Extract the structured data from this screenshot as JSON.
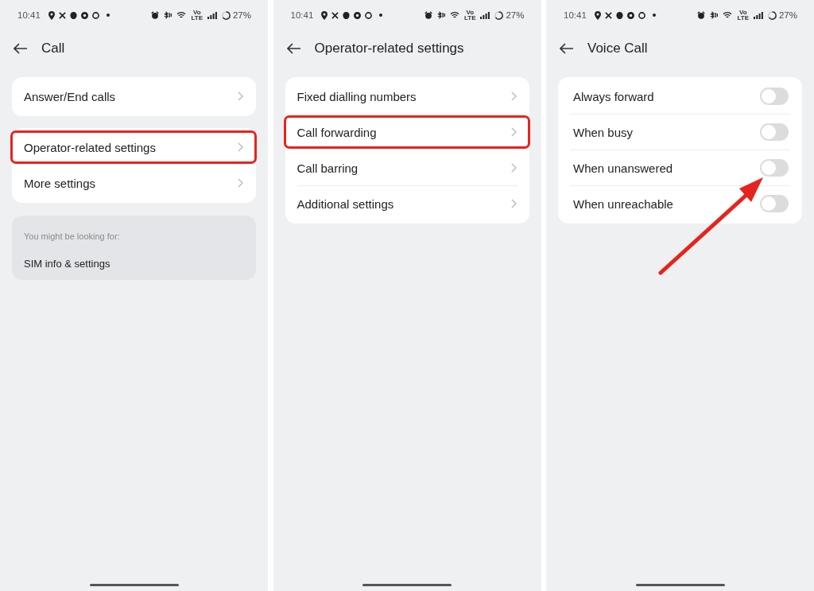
{
  "screens": [
    {
      "status_bar": {
        "time": "10:41",
        "network_type": "Vo LTE",
        "battery": "27%"
      },
      "title": "Call",
      "groups": [
        {
          "items": [
            {
              "kind": "link",
              "label": "Answer/End calls",
              "highlighted": false
            }
          ]
        },
        {
          "items": [
            {
              "kind": "link",
              "label": "Operator-related settings",
              "highlighted": true
            },
            {
              "kind": "link",
              "label": "More settings",
              "highlighted": false
            }
          ]
        }
      ],
      "suggestions": {
        "heading": "You might be looking for:",
        "links": [
          "SIM info & settings"
        ]
      }
    },
    {
      "status_bar": {
        "time": "10:41",
        "network_type": "Vo LTE",
        "battery": "27%"
      },
      "title": "Operator-related settings",
      "groups": [
        {
          "items": [
            {
              "kind": "link",
              "label": "Fixed dialling numbers",
              "highlighted": false
            },
            {
              "kind": "link",
              "label": "Call forwarding",
              "highlighted": true
            },
            {
              "kind": "link",
              "label": "Call barring",
              "highlighted": false
            },
            {
              "kind": "link",
              "label": "Additional settings",
              "highlighted": false
            }
          ]
        }
      ]
    },
    {
      "status_bar": {
        "time": "10:41",
        "network_type": "Vo LTE",
        "battery": "27%"
      },
      "title": "Voice Call",
      "groups": [
        {
          "items": [
            {
              "kind": "toggle",
              "label": "Always forward",
              "on": false
            },
            {
              "kind": "toggle",
              "label": "When busy",
              "on": false
            },
            {
              "kind": "toggle",
              "label": "When unanswered",
              "on": false
            },
            {
              "kind": "toggle",
              "label": "When unreachable",
              "on": false
            }
          ]
        }
      ],
      "pointer_arrow": true
    }
  ]
}
